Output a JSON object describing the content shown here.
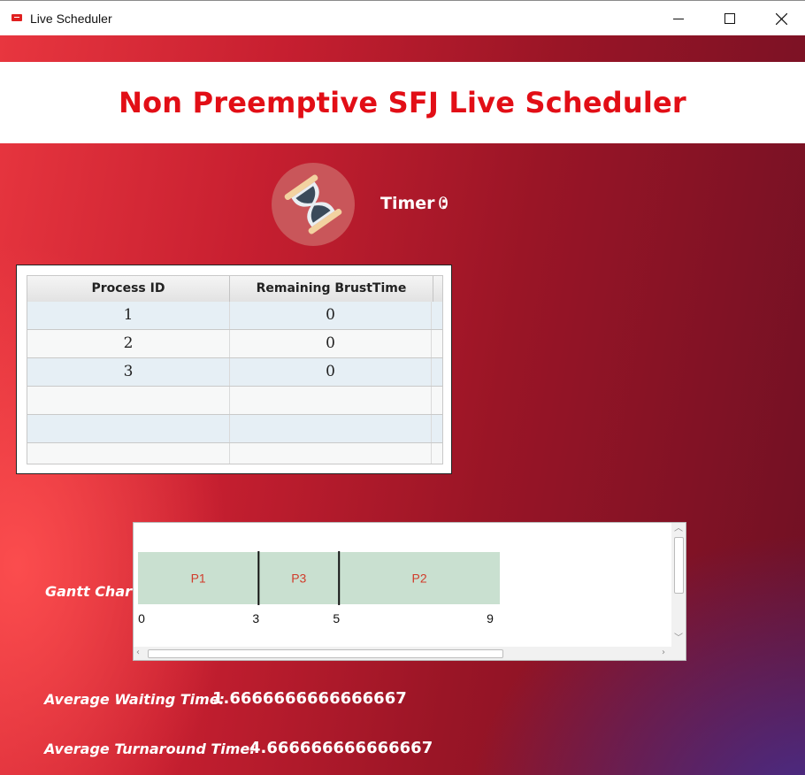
{
  "window": {
    "title": "Live Scheduler",
    "icon": "live-app-icon"
  },
  "header": {
    "title": "Non Preemptive SFJ Live Scheduler"
  },
  "timer": {
    "icon": "hourglass-icon",
    "label": "Timer :",
    "value": "0"
  },
  "process_table": {
    "columns": [
      "Process ID",
      "Remaining BrustTime"
    ],
    "rows": [
      {
        "pid": "1",
        "remaining": "0"
      },
      {
        "pid": "2",
        "remaining": "0"
      },
      {
        "pid": "3",
        "remaining": "0"
      },
      {
        "pid": "",
        "remaining": ""
      },
      {
        "pid": "",
        "remaining": ""
      },
      {
        "pid": "",
        "remaining": ""
      }
    ]
  },
  "gantt": {
    "label": "Gantt Chart:",
    "blocks": [
      {
        "name": "P1",
        "start": 0,
        "end": 3
      },
      {
        "name": "P3",
        "start": 3,
        "end": 5
      },
      {
        "name": "P2",
        "start": 5,
        "end": 9
      }
    ],
    "ticks": [
      "0",
      "3",
      "5",
      "9"
    ],
    "colors": {
      "block": "#c9e0d0",
      "text": "#d13b2a",
      "divider": "#111111"
    }
  },
  "stats": {
    "avg_waiting_label": "Average Waiting Time:",
    "avg_waiting_value": "1.6666666666666667",
    "avg_turnaround_label": "Average Turnaround Time:",
    "avg_turnaround_value": "4.666666666666667"
  },
  "colors": {
    "title_red": "#e20e16",
    "background_red": "#c71f30",
    "background_purple": "#462d8c"
  }
}
